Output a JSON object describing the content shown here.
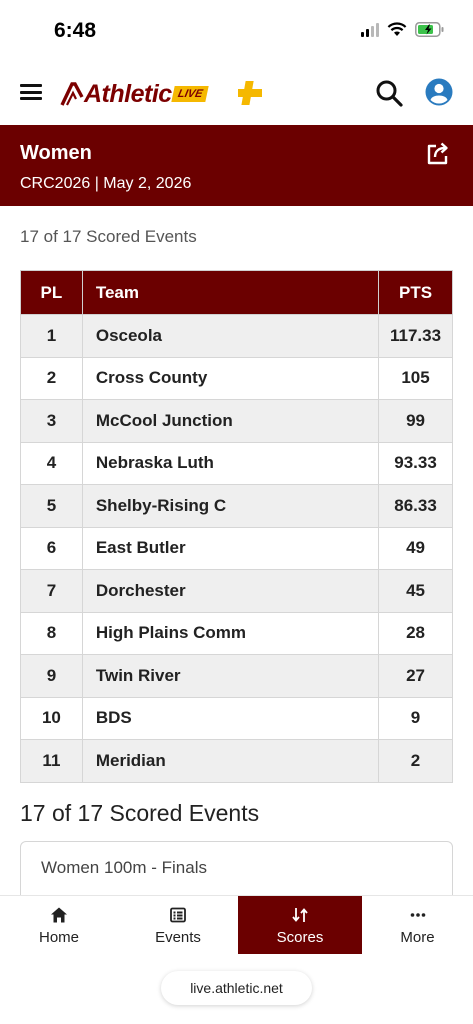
{
  "status": {
    "time": "6:48"
  },
  "header": {
    "logo_text": "Athletic",
    "logo_badge": "LIVE"
  },
  "banner": {
    "title": "Women",
    "subtitle": "CRC2026 | May 2, 2026"
  },
  "scored_events_small": "17 of 17 Scored Events",
  "table": {
    "headers": {
      "place": "PL",
      "team": "Team",
      "points": "PTS"
    },
    "rows": [
      {
        "pl": "1",
        "team": "Osceola",
        "pts": "117.33"
      },
      {
        "pl": "2",
        "team": "Cross County",
        "pts": "105"
      },
      {
        "pl": "3",
        "team": "McCool Junction",
        "pts": "99"
      },
      {
        "pl": "4",
        "team": "Nebraska Luth",
        "pts": "93.33"
      },
      {
        "pl": "5",
        "team": "Shelby-Rising C",
        "pts": "86.33"
      },
      {
        "pl": "6",
        "team": "East Butler",
        "pts": "49"
      },
      {
        "pl": "7",
        "team": "Dorchester",
        "pts": "45"
      },
      {
        "pl": "8",
        "team": "High Plains Comm",
        "pts": "28"
      },
      {
        "pl": "9",
        "team": "Twin River",
        "pts": "27"
      },
      {
        "pl": "10",
        "team": "BDS",
        "pts": "9"
      },
      {
        "pl": "11",
        "team": "Meridian",
        "pts": "2"
      }
    ]
  },
  "scored_events_large": "17 of 17 Scored Events",
  "events": [
    {
      "name": "Women 100m - Finals"
    }
  ],
  "nav": {
    "items": [
      {
        "label": "Home",
        "icon": "home-icon"
      },
      {
        "label": "Events",
        "icon": "list-icon"
      },
      {
        "label": "Scores",
        "icon": "sort-icon",
        "active": true
      },
      {
        "label": "More",
        "icon": "more-icon"
      }
    ]
  },
  "browser": {
    "url": "live.athletic.net"
  },
  "colors": {
    "brand": "#6b0000",
    "accent": "#f5b800",
    "avatar": "#2a7bbf"
  }
}
